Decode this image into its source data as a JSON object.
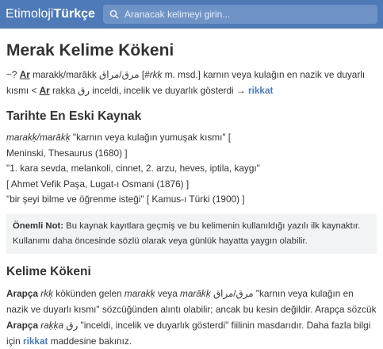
{
  "brand": {
    "part1": "Etimoloji",
    "part2": "Türkçe"
  },
  "search": {
    "placeholder": "Aranacak kelimeyi girin..."
  },
  "page_title": "Merak Kelime Kökeni",
  "summary": {
    "t1": "~? ",
    "lang1": "Ar",
    "t2": " marakḳ/marākḳ ",
    "arabic1": "مرق/مراق",
    "t3": " [",
    "root1": "#rkḳ",
    "t4": " m. msd.] karnın veya kulağın en nazik ve duyarlı kısmı < ",
    "lang2": "Ar",
    "t5": " raḳḳa ",
    "arabic2": "رق",
    "t6": " inceldi, incelik ve duyarlık gösterdi → ",
    "link": "rikkat"
  },
  "history": {
    "heading": "Tarihte En Eski Kaynak",
    "line1_italic": "marakḳ/marākḳ",
    "line1_rest": " \"karnın veya kulağın yumuşak kısmı\" [",
    "line2": "Meninski, Thesaurus (1680) ]",
    "line3": "\"1. kara sevda, melankoli, cinnet, 2. arzu, heves, iptila, kaygı\"",
    "line4": "[ Ahmet Vefik Paşa, Lugat-ı Osmani (1876) ]",
    "line5": "\"bir şeyi bilme ve öğrenme isteği\" [ Kamus-ı Türki (1900) ]"
  },
  "note": {
    "label": "Önemli Not:",
    "text": " Bu kaynak kayıtlara geçmiş ve bu kelimenin kullanıldığı yazılı ilk kaynaktır. Kullanımı daha öncesinde sözlü olarak veya günlük hayatta yaygın olabilir."
  },
  "origin": {
    "heading": "Kelime Kökeni",
    "lang1": "Arapça",
    "root": "rkḳ",
    "t1": " kökünden gelen ",
    "word1": "marakḳ",
    "t2": " veya ",
    "word2": "marākḳ",
    "t3": " مرق/مراق \"karnın veya kulağın en nazik ve duyarlı kısmı\" sözcüğünden alıntı olabilir; ancak bu kesin değildir. Arapça sözcük ",
    "lang2": "Arapça",
    "word3": "raḳḳa",
    "t4": " رق \"inceldi, incelik ve duyarlık gösterdi\" fiilinin masdarıdır. Daha fazla bilgi için ",
    "link": "rikkat",
    "t5": " maddesine bakınız."
  }
}
